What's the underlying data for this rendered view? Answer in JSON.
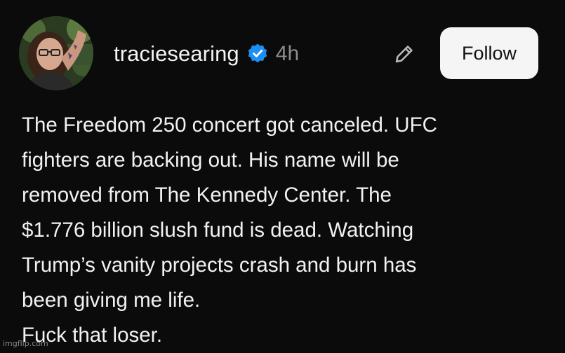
{
  "post": {
    "username": "traciesearing",
    "timestamp": "4h",
    "follow_label": "Follow",
    "text": "The Freedom 250 concert got canceled. UFC\nfighters are backing out. His name will be\nremoved from The Kennedy Center. The\n$1.776 billion slush fund is dead. Watching\nTrump’s vanity projects crash and burn has\nbeen giving me life.\nFuck that loser."
  },
  "icons": {
    "verified": "verified-badge-icon",
    "edit": "pencil-icon"
  },
  "colors": {
    "background": "#0b0b0b",
    "verified_badge": "#1d8ff2",
    "timestamp": "#8d8d8d",
    "follow_button_bg": "#f5f5f5",
    "follow_button_text": "#111111"
  },
  "watermark": "imgflip.com"
}
